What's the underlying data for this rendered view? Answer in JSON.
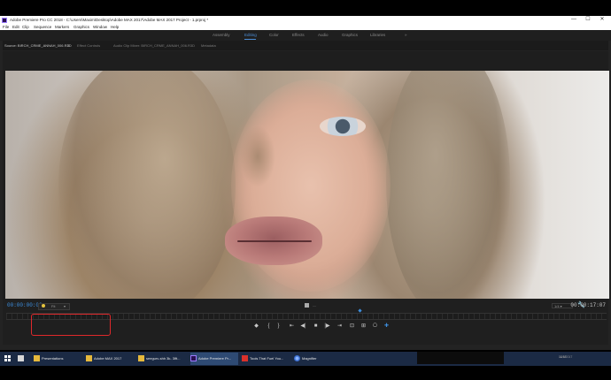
{
  "window": {
    "title": "Adobe Premiere Pro CC 2018 - C:\\Users\\Maxim\\Desktop\\Adobe MAX 2017\\Adobe MAX 2017 Project - 1.prproj *",
    "controls": {
      "minimize": "—",
      "maximize": "☐",
      "close": "✕"
    }
  },
  "menu": [
    "File",
    "Edit",
    "Clip",
    "Sequence",
    "Markers",
    "Graphics",
    "Window",
    "Help"
  ],
  "workspaces": {
    "items": [
      "Assembly",
      "Editing",
      "Color",
      "Effects",
      "Audio",
      "Graphics",
      "Libraries"
    ],
    "more": "»",
    "active": "Editing"
  },
  "panel_tabs": [
    {
      "label": "Source: BIRCH_CRME_ANNAH_006.R3D",
      "active": true,
      "close": "≡"
    },
    {
      "label": "Effect Controls",
      "active": false
    },
    {
      "label": "Audio Clip Mixer: BIRCH_CRME_ANNAH_006.R3D",
      "active": false
    },
    {
      "label": "Metadata",
      "active": false
    }
  ],
  "monitor": {
    "timecode_in": "00:00:00:00",
    "timecode_duration": "00:00:17:07",
    "fit_value": "Fit",
    "resolution_value": "1/4",
    "mid_label": "—",
    "highlight_color": "#e0282b",
    "accent_color": "#3d8ede"
  },
  "transport": [
    {
      "name": "add-marker-button",
      "glyph": "◆"
    },
    {
      "name": "mark-in-button",
      "glyph": "{"
    },
    {
      "name": "mark-out-button",
      "glyph": "}"
    },
    {
      "name": "go-to-in-button",
      "glyph": "⇤"
    },
    {
      "name": "step-back-button",
      "glyph": "◀|"
    },
    {
      "name": "play-button",
      "glyph": "■"
    },
    {
      "name": "step-forward-button",
      "glyph": "|▶"
    },
    {
      "name": "go-to-out-button",
      "glyph": "⇥"
    },
    {
      "name": "insert-button",
      "glyph": "⊡"
    },
    {
      "name": "overwrite-button",
      "glyph": "⊞"
    },
    {
      "name": "export-frame-button",
      "glyph": "⎔"
    },
    {
      "name": "button-editor-button",
      "glyph": "✚"
    }
  ],
  "taskbar": {
    "items": [
      {
        "label": "",
        "icon": "mail-icon"
      },
      {
        "label": "Presentations",
        "icon": "folder-icon"
      },
      {
        "label": "Adobe MAX 2017",
        "icon": "folder-icon"
      },
      {
        "label": "seegurv-shh 3k- 3lft...",
        "icon": "folder-icon"
      },
      {
        "label": "Adobe Premiere Pr...",
        "icon": "premiere-icon",
        "active": true
      },
      {
        "label": "Tools That Fuel You...",
        "icon": "pdf-icon"
      },
      {
        "label": "Magnifier",
        "icon": "magnifier-icon"
      }
    ],
    "tray_time": "14:51",
    "tray_date": "11/1/2017"
  }
}
